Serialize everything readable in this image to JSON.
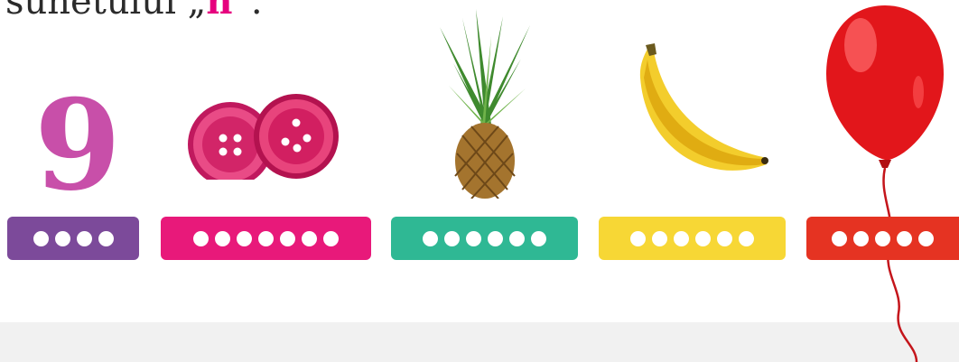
{
  "heading": {
    "prefix": "sunetului ",
    "open_quote": "„",
    "sound": "n",
    "close_quote": "”."
  },
  "items": [
    {
      "name": "nine",
      "label": "9",
      "icon": "number-nine-icon",
      "syllable_dots": 4,
      "color": "#7c4a9a"
    },
    {
      "name": "buttons",
      "icon": "buttons-icon",
      "syllable_dots": 7,
      "color": "#e8197a"
    },
    {
      "name": "pineapple",
      "icon": "pineapple-icon",
      "syllable_dots": 6,
      "color": "#2fb894"
    },
    {
      "name": "banana",
      "icon": "banana-icon",
      "syllable_dots": 6,
      "color": "#f7d735"
    },
    {
      "name": "balloon",
      "icon": "balloon-icon",
      "syllable_dots": 5,
      "color": "#e53322"
    }
  ]
}
